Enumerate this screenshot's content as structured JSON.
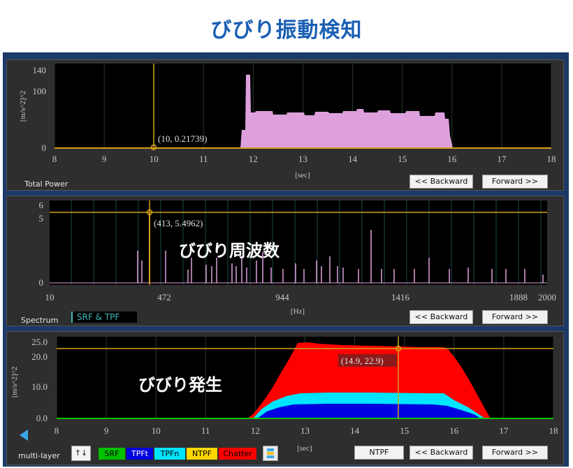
{
  "title": "びびり振動検知",
  "panel1": {
    "label": "Total Power",
    "ylabel": "[m/s^2]^2",
    "xlabel": "[sec]",
    "yticks": [
      "140",
      "100",
      "0"
    ],
    "xticks": [
      "8",
      "9",
      "10",
      "11",
      "12",
      "13",
      "14",
      "15",
      "16",
      "17",
      "18"
    ],
    "cursor": "(10, 0.21739)",
    "backward": "<< Backward",
    "forward": "Forward >>"
  },
  "panel2": {
    "label": "Spectrum",
    "mode": "SRF & TPF",
    "xlabel": "[Hz]",
    "yticks": [
      "6",
      "5",
      "0"
    ],
    "xticks": [
      "10",
      "472",
      "944",
      "1416",
      "1888",
      "2000"
    ],
    "cursor": "(413, 5.4962)",
    "overlay": "びびり周波数",
    "backward": "<< Backward",
    "forward": "Forward >>"
  },
  "panel3": {
    "label": "multi-layer",
    "ylabel": "[m/s^2]^2",
    "xlabel": "[sec]",
    "yticks": [
      "25.0",
      "20.0",
      "10.0",
      "0.0"
    ],
    "xticks": [
      "8",
      "9",
      "10",
      "11",
      "12",
      "13",
      "14",
      "15",
      "16",
      "17",
      "18"
    ],
    "cursor": "(14.9, 22.9)",
    "overlay": "びびり発生",
    "sort_button": "↑↓",
    "legend": [
      {
        "label": "SRF",
        "bg": "#00c000",
        "fg": "#000000"
      },
      {
        "label": "TPFt",
        "bg": "#0000e0",
        "fg": "#ffffff"
      },
      {
        "label": "TPFn",
        "bg": "#00e5ff",
        "fg": "#000000"
      },
      {
        "label": "NTPF",
        "bg": "#ffd700",
        "fg": "#000000"
      },
      {
        "label": "Chatter",
        "bg": "#ff0000",
        "fg": "#000000"
      }
    ],
    "ntpf_button": "NTPF",
    "backward": "<< Backward",
    "forward": "Forward >>"
  },
  "colors": {
    "cursor": "#d4a017",
    "power_fill": "#dda0dd",
    "spectrum_line": "#dda0dd",
    "chatter": "#ff0000",
    "tpfn": "#00e5ff",
    "tpft": "#0000e0",
    "srf": "#00c000"
  }
}
